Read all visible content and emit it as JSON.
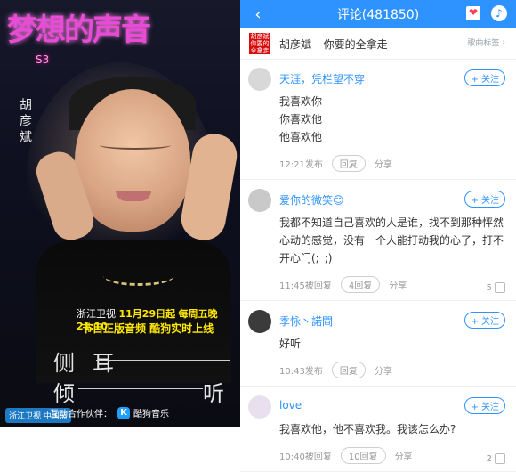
{
  "poster": {
    "name_vertical": "胡彦斌",
    "logo_text": "梦想的声音",
    "logo_sub": "S3",
    "promo_line1": {
      "prefix": "浙江卫视",
      "date": "11月29日起",
      "time": "每周五晚21:10"
    },
    "promo_line2": "节目正版音频 酷狗实时上线",
    "lyric_a": "侧耳",
    "lyric_b_left": "倾",
    "lyric_b_right": "听",
    "sponsor_label": "互动合作伙伴：",
    "sponsor_name": "酷狗音乐",
    "tv_logo": "浙江卫视 中国蓝"
  },
  "header": {
    "title": "评论(481850)",
    "back_icon": "chevron-left-icon",
    "heart_icon": "heart-icon",
    "music_icon": "music-icon"
  },
  "song": {
    "cover_text": "胡彦斌 你要的 全拿走",
    "title": "胡彦斌 – 你要的全拿走",
    "tag_label": "歌曲标签"
  },
  "comments": [
    {
      "user": "天涯，凭栏望不穿",
      "text": "我喜欢你\n你喜欢他\n他喜欢他",
      "time": "12:21发布",
      "reply": "回复",
      "share": "分享",
      "follow": "+ 关注",
      "likes": "",
      "avatar_color": "#d8d8d8"
    },
    {
      "user": "爱你的微笑😊",
      "text": "我都不知道自己喜欢的人是谁，找不到那种怦然心动的感觉，没有一个人能打动我的心了，打不开心门(;_;)",
      "time": "11:45被回复",
      "reply": "4回复",
      "share": "分享",
      "follow": "+ 关注",
      "likes": "5",
      "avatar_color": "#c9c9c9"
    },
    {
      "user": "季怺丶諾閰",
      "text": "好听",
      "time": "10:43发布",
      "reply": "回复",
      "share": "分享",
      "follow": "+ 关注",
      "likes": "",
      "avatar_color": "#3b3b3b"
    },
    {
      "user": "love",
      "text": "我喜欢他，他不喜欢我。我该怎么办?",
      "time": "10:40被回复",
      "reply": "10回复",
      "share": "分享",
      "follow": "+ 关注",
      "likes": "2",
      "avatar_color": "#e9e0ef"
    }
  ],
  "colors": {
    "topbar_blue": "#2f93ff",
    "link_blue": "#2f93ff",
    "text_dark": "#333333",
    "text_meta": "#999999",
    "accent_yellow": "#ffe800",
    "poster_bg": "#0e1020"
  }
}
